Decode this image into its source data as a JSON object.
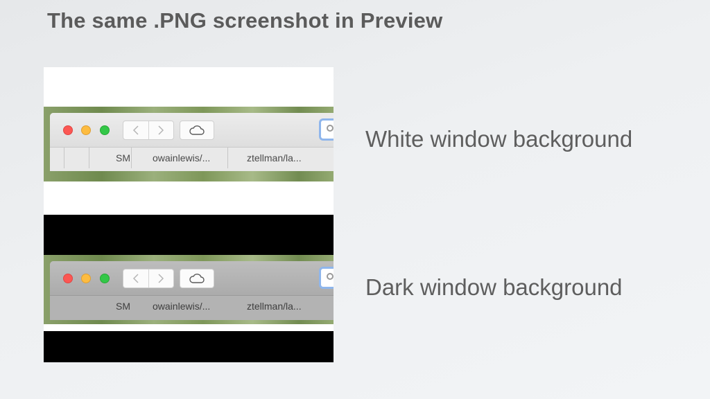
{
  "slide": {
    "title": "The same .PNG screenshot in Preview",
    "caption_top": "White window background",
    "caption_bottom": "Dark window background"
  },
  "screenshot": {
    "tabs": [
      "SM",
      "owainlewis/...",
      "ztellman/la..."
    ],
    "traffic_lights": {
      "close_color": "#fc5753",
      "minimize_color": "#fdbc40",
      "maximize_color": "#33c748"
    },
    "icons": {
      "back": "chevron-left-icon",
      "forward": "chevron-right-icon",
      "icloud": "cloud-icon",
      "search": "search-icon"
    },
    "backgrounds": {
      "top": "#ffffff",
      "bottom": "#000000"
    }
  }
}
